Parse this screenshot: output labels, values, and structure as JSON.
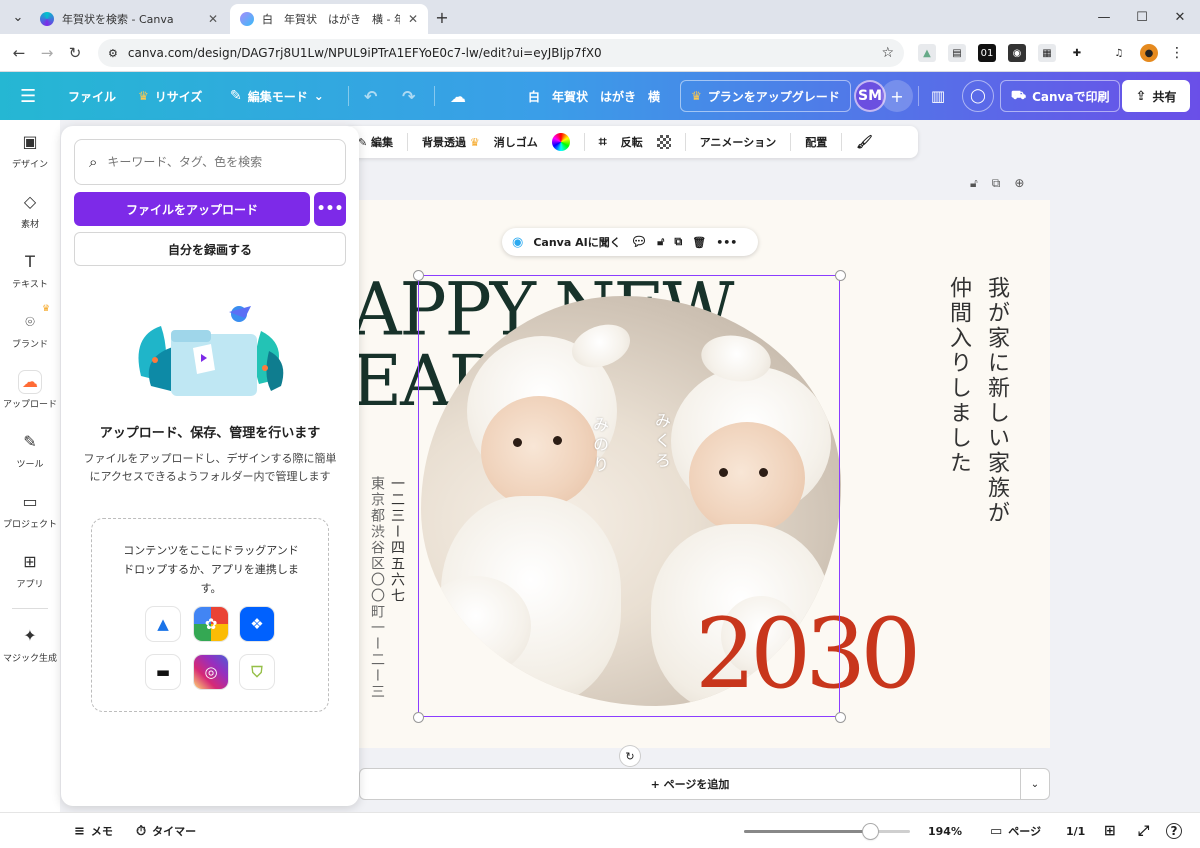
{
  "browser": {
    "tabs": [
      {
        "title": "年賀状を検索 - Canva",
        "active": false
      },
      {
        "title": "白　年賀状　はがき　横 - 年賀状",
        "active": true
      }
    ],
    "url": "canva.com/design/DAG7rj8U1Lw/NPUL9iPTrA1EFYoE0c7-lw/edit?ui=eyJBIjp7fX0",
    "ext_label": "01"
  },
  "header": {
    "menu_file": "ファイル",
    "resize": "リサイズ",
    "edit_mode": "編集モード",
    "doc_title": "白　年賀状　はがき　横",
    "upgrade": "プランをアップグレード",
    "avatar_initials": "SM",
    "print": "Canvaで印刷",
    "share": "共有"
  },
  "rail": [
    {
      "label": "デザイン",
      "icon": "design-icon",
      "glyph": "▣"
    },
    {
      "label": "素材",
      "icon": "elements-icon",
      "glyph": "◇"
    },
    {
      "label": "テキスト",
      "icon": "text-icon",
      "glyph": "T"
    },
    {
      "label": "ブランド",
      "icon": "brand-icon",
      "glyph": "⌾"
    },
    {
      "label": "アップロード",
      "icon": "upload-icon",
      "glyph": "☁"
    },
    {
      "label": "ツール",
      "icon": "tools-icon",
      "glyph": "✎"
    },
    {
      "label": "プロジェクト",
      "icon": "folder-icon",
      "glyph": "▭"
    },
    {
      "label": "アプリ",
      "icon": "apps-icon",
      "glyph": "⊞"
    },
    {
      "label": "マジック生成",
      "icon": "magic-icon",
      "glyph": "✦"
    }
  ],
  "panel": {
    "search_placeholder": "キーワード、タグ、色を検索",
    "upload_button": "ファイルをアップロード",
    "record_button": "自分を録画する",
    "title": "アップロード、保存、管理を行います",
    "description": "ファイルをアップロードし、デザインする際に簡単にアクセスできるようフォルダー内で管理します",
    "drop_text": "コンテンツをここにドラッグアンドドロップするか、アプリを連携します。"
  },
  "image_toolbar": {
    "edit": "編集",
    "bg_remove": "背景透過",
    "eraser": "消しゴム",
    "flip": "反転",
    "animation": "アニメーション",
    "position": "配置"
  },
  "design": {
    "hny_line1": "APPY NEW",
    "hny_line2": "EAR",
    "name_left": "みのり",
    "name_right": "みくろ",
    "message": "我が家に新しい家族が仲間入りしました",
    "address_line1": "一二三ー四五六七",
    "address_line2": "東京都渋谷区〇〇町一ー二ー三",
    "year": "2030"
  },
  "float_bar": {
    "ai_label": "Canva AIに聞く"
  },
  "add_page": "+ ページを追加",
  "bottom": {
    "memo": "メモ",
    "timer": "タイマー",
    "zoom": "194%",
    "zoom_fraction": 0.76,
    "pages": "ページ",
    "page_count": "1/1"
  },
  "colors": {
    "brand_purple": "#7d2ae8",
    "year_red": "#c8361c",
    "hny_green": "#17322a"
  }
}
